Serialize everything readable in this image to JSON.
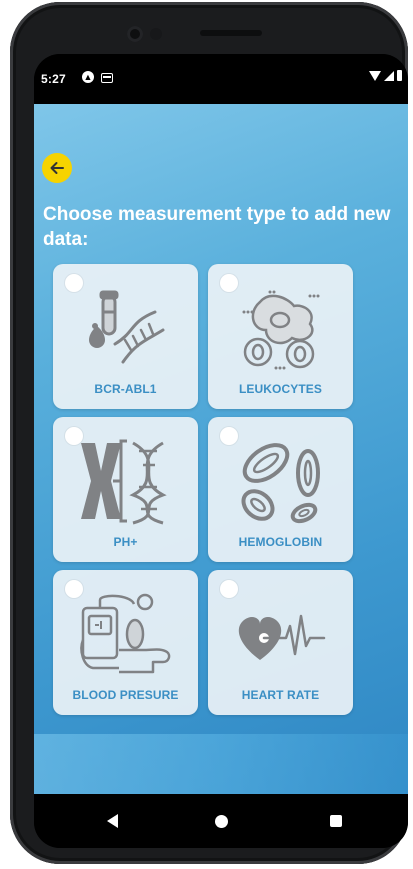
{
  "status_bar": {
    "time": "5:27",
    "icons": [
      "android-notification-icon",
      "message-icon",
      "wifi-icon",
      "signal-icon",
      "battery-icon"
    ]
  },
  "header": {
    "back_icon": "arrow-left-icon",
    "title": "Choose measurement type to add new data:"
  },
  "measurement_types": [
    {
      "label": "BCR-ABL1",
      "icon": "dna-test-tube-icon",
      "selected": false
    },
    {
      "label": "LEUKOCYTES",
      "icon": "leukocyte-cells-icon",
      "selected": false
    },
    {
      "label": "PH+",
      "icon": "chromosome-dna-icon",
      "selected": false
    },
    {
      "label": "HEMOGLOBIN",
      "icon": "red-blood-cells-icon",
      "selected": false
    },
    {
      "label": "BLOOD PRESURE",
      "icon": "blood-pressure-monitor-icon",
      "selected": false
    },
    {
      "label": "HEART RATE",
      "icon": "heart-rate-icon",
      "selected": false
    }
  ],
  "navigation_bar": {
    "buttons": [
      "back-icon",
      "home-icon",
      "recents-icon"
    ]
  },
  "colors": {
    "accent_yellow": "#f6d300",
    "label_blue": "#3b8fc4",
    "background_blue": "#4aa3d6",
    "illustration_gray": "#808285"
  }
}
